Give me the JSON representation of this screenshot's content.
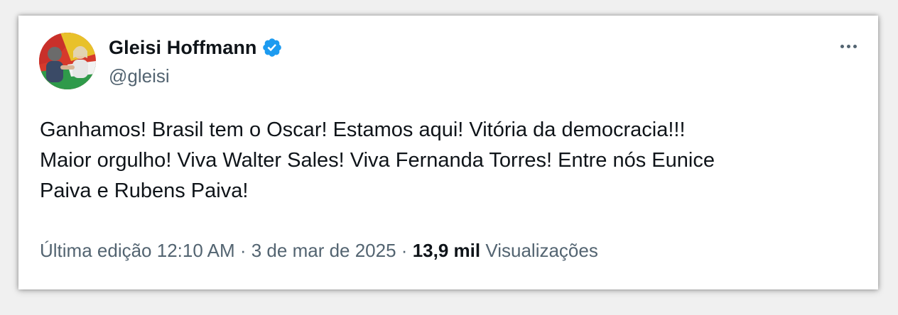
{
  "author": {
    "name": "Gleisi Hoffmann",
    "handle": "@gleisi",
    "verified": true,
    "verified_color": "#1d9bf0"
  },
  "tweet": {
    "lines": [
      "Ganhamos! Brasil tem o Oscar! Estamos aqui! Vitória da democracia!!!",
      "Maior orgulho! Viva Walter Sales! Viva Fernanda Torres! Entre nós Eunice",
      "Paiva e Rubens Paiva!"
    ]
  },
  "meta": {
    "edited_label": "Última edição",
    "time": "12:10 AM",
    "separator": "·",
    "date": "3 de mar de 2025",
    "views_count": "13,9 mil",
    "views_label": "Visualizações"
  },
  "icons": {
    "more": "more-options-icon",
    "verified": "verified-badge-icon"
  }
}
